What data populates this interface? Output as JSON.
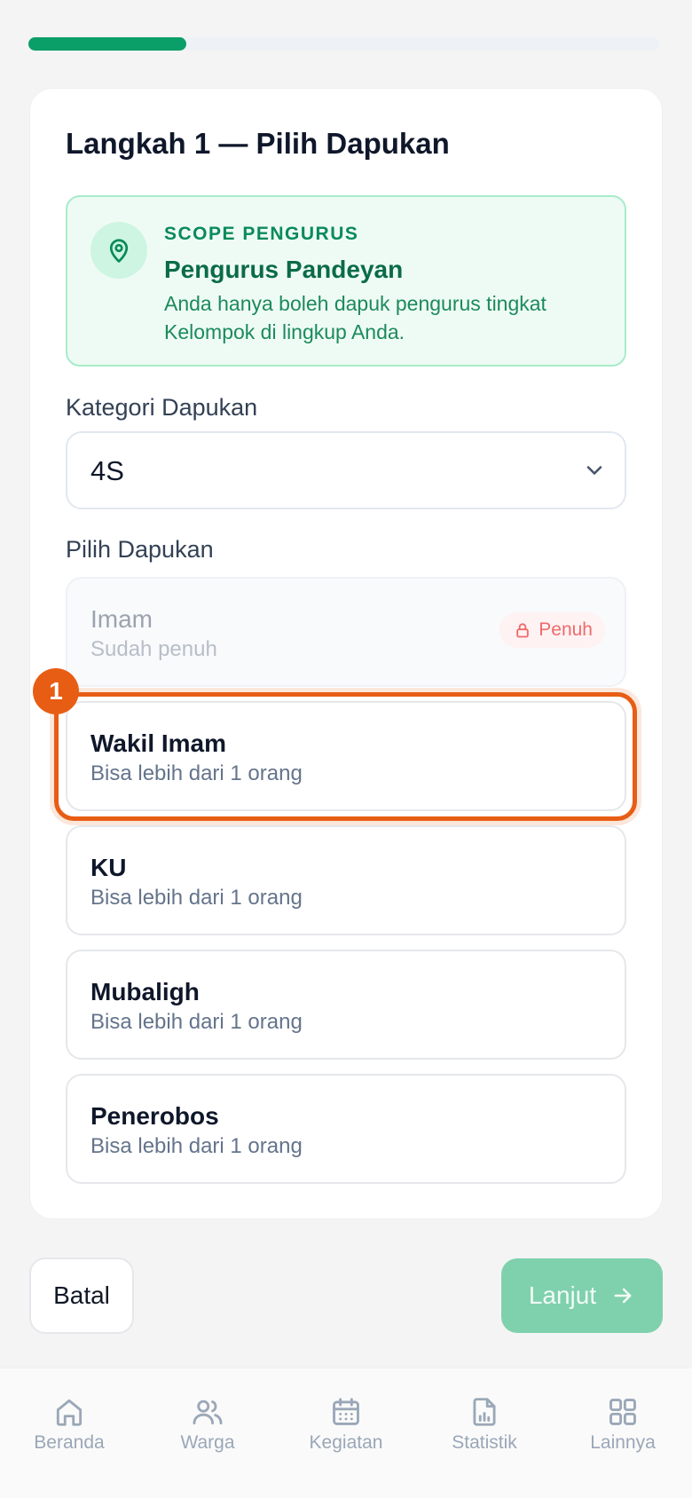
{
  "progress": {
    "fraction": 0.25
  },
  "step": {
    "title": "Langkah 1 — Pilih Dapukan"
  },
  "scope": {
    "icon": "map-pin-icon",
    "kicker": "SCOPE PENGURUS",
    "name": "Pengurus Pandeyan",
    "description": "Anda hanya boleh dapuk pengurus tingkat Kelompok di lingkup Anda."
  },
  "category": {
    "label": "Kategori Dapukan",
    "value": "4S"
  },
  "dapukan": {
    "label": "Pilih Dapukan",
    "options": [
      {
        "name": "Imam",
        "sub": "Sudah penuh",
        "badge": "Penuh",
        "disabled": true
      },
      {
        "name": "Wakil Imam",
        "sub": "Bisa lebih dari 1 orang"
      },
      {
        "name": "KU",
        "sub": "Bisa lebih dari 1 orang"
      },
      {
        "name": "Mubaligh",
        "sub": "Bisa lebih dari 1 orang"
      },
      {
        "name": "Penerobos",
        "sub": "Bisa lebih dari 1 orang"
      }
    ]
  },
  "marker": {
    "number": "1"
  },
  "actions": {
    "cancel": "Batal",
    "next": "Lanjut"
  },
  "nav": [
    {
      "label": "Beranda",
      "icon": "home-icon"
    },
    {
      "label": "Warga",
      "icon": "users-icon"
    },
    {
      "label": "Kegiatan",
      "icon": "calendar-icon"
    },
    {
      "label": "Statistik",
      "icon": "report-chart-icon"
    },
    {
      "label": "Lainnya",
      "icon": "grid-icon"
    }
  ],
  "colors": {
    "primary": "#0a9e68",
    "highlight": "#e85d14",
    "danger": "#ef6b6b"
  }
}
